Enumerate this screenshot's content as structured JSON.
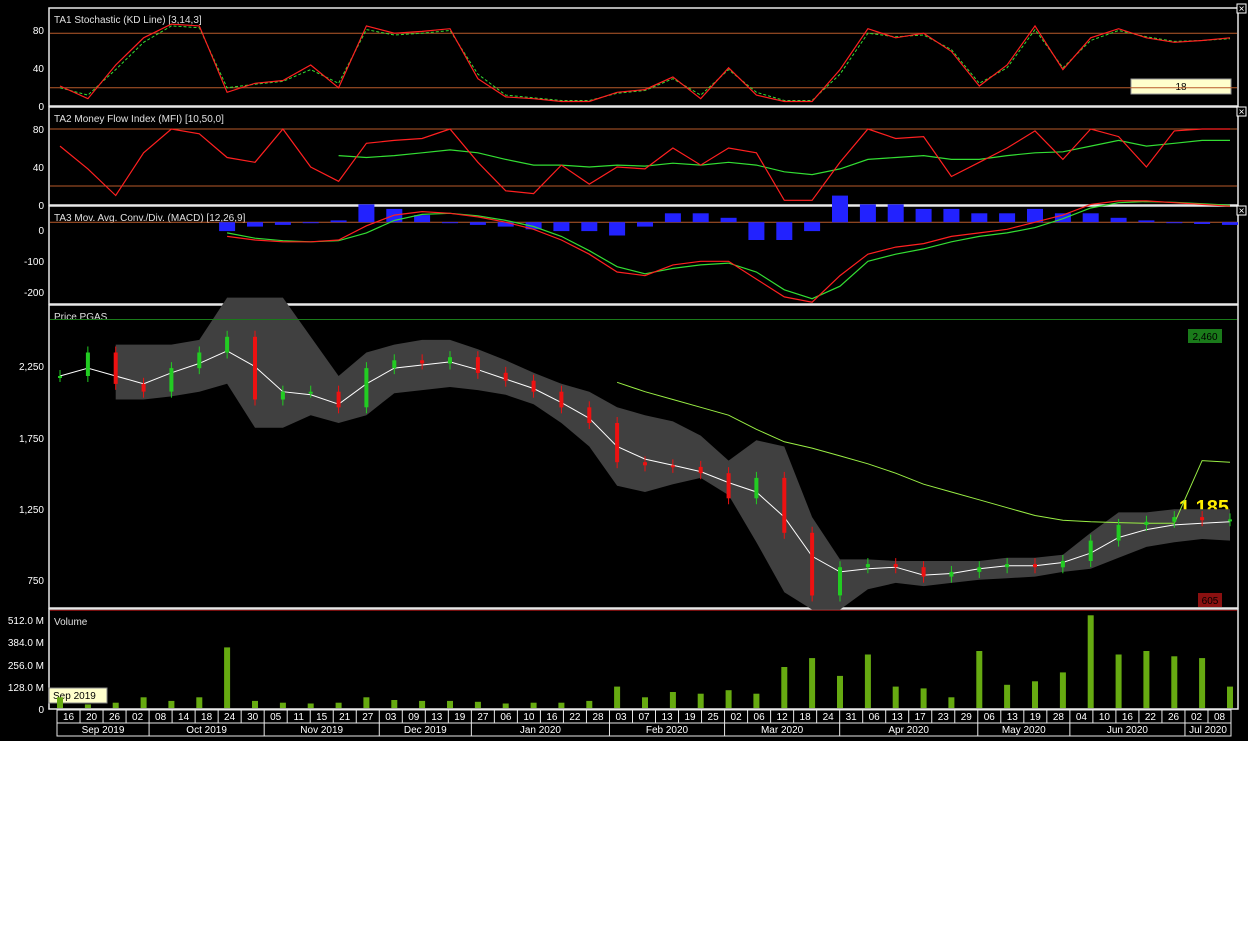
{
  "panels": {
    "stoch": {
      "title": "TA1 Stochastic (KD Line) [3,14,3]",
      "ticks": [
        "80",
        "40",
        "0"
      ],
      "badge": "18"
    },
    "mfi": {
      "title": "TA2 Money Flow Index (MFI) [10,50,0]",
      "ticks": [
        "80",
        "40",
        "0"
      ]
    },
    "macd": {
      "title": "TA3 Mov. Avg. Conv./Div. (MACD) [12,26,9]",
      "ticks": [
        "0",
        "-100",
        "-200"
      ]
    },
    "price": {
      "title": "Price PGAS",
      "ticks": [
        "2,250",
        "1,750",
        "1,250",
        "750"
      ],
      "high_label": "2,460",
      "low_label": "605",
      "last_label": "1.185"
    },
    "volume": {
      "title": "Volume",
      "ticks": [
        "512.0 M",
        "384.0 M",
        "256.0 M",
        "128.0 M",
        "0"
      ],
      "tooltip": "Sep 2019"
    }
  },
  "xaxis": {
    "days": [
      "16",
      "20",
      "26",
      "02",
      "08",
      "14",
      "18",
      "24",
      "30",
      "05",
      "11",
      "15",
      "21",
      "27",
      "03",
      "09",
      "13",
      "19",
      "27",
      "06",
      "10",
      "16",
      "22",
      "28",
      "03",
      "07",
      "13",
      "19",
      "25",
      "02",
      "06",
      "12",
      "18",
      "24",
      "31",
      "06",
      "13",
      "17",
      "23",
      "29",
      "06",
      "13",
      "19",
      "28",
      "04",
      "10",
      "16",
      "22",
      "26",
      "02",
      "08"
    ],
    "months": [
      "Sep 2019",
      "Oct 2019",
      "Nov 2019",
      "Dec 2019",
      "Jan 2020",
      "Feb 2020",
      "Mar 2020",
      "Apr 2020",
      "May 2020",
      "Jun 2020",
      "Jul 2020"
    ]
  },
  "colors": {
    "background": "#000000",
    "up": "#22cc22",
    "down": "#ee1111",
    "stoch_k": "#ff2020",
    "stoch_d": "#33dd33",
    "histogram": "#2222ff",
    "band": "#404040",
    "ma_long": "#99ee44",
    "volume": "#66aa11",
    "last_price": "#ffee00"
  },
  "chart_data": [
    {
      "type": "line",
      "title": "TA1 Stochastic (KD Line) [3,14,3]",
      "ylim": [
        0,
        100
      ],
      "reference_lines": [
        80,
        20
      ],
      "x": [
        "2019-09-16",
        "2019-09-24",
        "2019-10-01",
        "2019-10-08",
        "2019-10-15",
        "2019-10-22",
        "2019-10-29",
        "2019-11-05",
        "2019-11-12",
        "2019-11-19",
        "2019-11-26",
        "2019-12-03",
        "2019-12-10",
        "2019-12-17",
        "2019-12-24",
        "2019-12-31",
        "2020-01-07",
        "2020-01-14",
        "2020-01-21",
        "2020-01-28",
        "2020-02-04",
        "2020-02-11",
        "2020-02-18",
        "2020-02-25",
        "2020-03-03",
        "2020-03-10",
        "2020-03-17",
        "2020-03-24",
        "2020-03-31",
        "2020-04-07",
        "2020-04-14",
        "2020-04-21",
        "2020-04-28",
        "2020-05-05",
        "2020-05-12",
        "2020-05-19",
        "2020-05-26",
        "2020-06-02",
        "2020-06-09",
        "2020-06-16",
        "2020-06-23",
        "2020-06-30",
        "2020-07-08"
      ],
      "series": [
        {
          "name": "K",
          "values": [
            22,
            8,
            45,
            75,
            90,
            88,
            15,
            25,
            28,
            45,
            20,
            88,
            80,
            82,
            85,
            30,
            10,
            8,
            5,
            5,
            15,
            18,
            32,
            8,
            42,
            12,
            5,
            5,
            40,
            85,
            75,
            80,
            60,
            22,
            45,
            88,
            40,
            75,
            85,
            75,
            70,
            72,
            75
          ]
        },
        {
          "name": "D",
          "values": [
            20,
            12,
            40,
            70,
            88,
            86,
            20,
            24,
            27,
            40,
            25,
            84,
            78,
            80,
            83,
            35,
            12,
            9,
            6,
            6,
            14,
            17,
            30,
            12,
            40,
            15,
            6,
            6,
            35,
            80,
            76,
            78,
            62,
            25,
            42,
            84,
            42,
            72,
            83,
            76,
            71,
            72,
            74
          ]
        }
      ]
    },
    {
      "type": "line",
      "title": "TA2 Money Flow Index (MFI) [10,50,0]",
      "ylim": [
        0,
        100
      ],
      "reference_lines": [
        80,
        20
      ],
      "x": [
        "2019-09-16",
        "2019-09-24",
        "2019-10-01",
        "2019-10-08",
        "2019-10-15",
        "2019-10-22",
        "2019-10-29",
        "2019-11-05",
        "2019-11-12",
        "2019-11-19",
        "2019-11-26",
        "2019-12-03",
        "2019-12-10",
        "2019-12-17",
        "2019-12-24",
        "2019-12-31",
        "2020-01-07",
        "2020-01-14",
        "2020-01-21",
        "2020-01-28",
        "2020-02-04",
        "2020-02-11",
        "2020-02-18",
        "2020-02-25",
        "2020-03-03",
        "2020-03-10",
        "2020-03-17",
        "2020-03-24",
        "2020-03-31",
        "2020-04-07",
        "2020-04-14",
        "2020-04-21",
        "2020-04-28",
        "2020-05-05",
        "2020-05-12",
        "2020-05-19",
        "2020-05-26",
        "2020-06-02",
        "2020-06-09",
        "2020-06-16",
        "2020-06-23",
        "2020-06-30",
        "2020-07-08"
      ],
      "series": [
        {
          "name": "MFI",
          "values": [
            62,
            38,
            10,
            55,
            80,
            75,
            50,
            45,
            80,
            40,
            25,
            65,
            68,
            70,
            80,
            45,
            15,
            12,
            42,
            22,
            40,
            38,
            60,
            42,
            60,
            55,
            5,
            5,
            45,
            80,
            70,
            72,
            30,
            45,
            60,
            78,
            48,
            80,
            72,
            40,
            78,
            80,
            80
          ]
        },
        {
          "name": "MFI signal",
          "values": [
            null,
            null,
            null,
            null,
            null,
            null,
            null,
            null,
            null,
            null,
            52,
            50,
            52,
            55,
            58,
            55,
            48,
            42,
            42,
            40,
            42,
            41,
            44,
            42,
            45,
            42,
            35,
            32,
            38,
            48,
            50,
            52,
            48,
            48,
            52,
            55,
            56,
            62,
            68,
            62,
            65,
            68,
            68
          ]
        }
      ]
    },
    {
      "type": "line",
      "title": "TA3 Mov. Avg. Conv./Div. (MACD) [12,26,9]",
      "ylim": [
        -230,
        40
      ],
      "x": [
        "2019-09-16",
        "2019-09-24",
        "2019-10-01",
        "2019-10-08",
        "2019-10-15",
        "2019-10-22",
        "2019-10-29",
        "2019-11-05",
        "2019-11-12",
        "2019-11-19",
        "2019-11-26",
        "2019-12-03",
        "2019-12-10",
        "2019-12-17",
        "2019-12-24",
        "2019-12-31",
        "2020-01-07",
        "2020-01-14",
        "2020-01-21",
        "2020-01-28",
        "2020-02-04",
        "2020-02-11",
        "2020-02-18",
        "2020-02-25",
        "2020-03-03",
        "2020-03-10",
        "2020-03-17",
        "2020-03-24",
        "2020-03-31",
        "2020-04-07",
        "2020-04-14",
        "2020-04-21",
        "2020-04-28",
        "2020-05-05",
        "2020-05-12",
        "2020-05-19",
        "2020-05-26",
        "2020-06-02",
        "2020-06-09",
        "2020-06-16",
        "2020-06-23",
        "2020-06-30",
        "2020-07-08"
      ],
      "series": [
        {
          "name": "MACD",
          "values": [
            null,
            null,
            null,
            null,
            null,
            null,
            -40,
            -50,
            -55,
            -55,
            -50,
            -10,
            20,
            30,
            25,
            15,
            0,
            -20,
            -50,
            -90,
            -140,
            -150,
            -120,
            -110,
            -110,
            -160,
            -210,
            -225,
            -150,
            -90,
            -70,
            -60,
            -40,
            -30,
            -20,
            0,
            20,
            50,
            60,
            60,
            55,
            50,
            45
          ]
        },
        {
          "name": "Signal",
          "values": [
            null,
            null,
            null,
            null,
            null,
            null,
            -30,
            -45,
            -52,
            -55,
            -52,
            -30,
            5,
            22,
            25,
            18,
            5,
            -12,
            -40,
            -80,
            -125,
            -145,
            -130,
            -120,
            -115,
            -140,
            -190,
            -215,
            -180,
            -110,
            -90,
            -75,
            -55,
            -40,
            -30,
            -15,
            10,
            40,
            55,
            58,
            56,
            52,
            48
          ]
        }
      ]
    },
    {
      "type": "line",
      "title": "Price PGAS",
      "ylim": [
        620,
        2540
      ],
      "reference_lines": [
        2460,
        605
      ],
      "last_price": 1185,
      "x": [
        "2019-09-16",
        "2019-09-24",
        "2019-10-01",
        "2019-10-08",
        "2019-10-15",
        "2019-10-22",
        "2019-10-29",
        "2019-11-05",
        "2019-11-12",
        "2019-11-19",
        "2019-11-26",
        "2019-12-03",
        "2019-12-10",
        "2019-12-17",
        "2019-12-24",
        "2019-12-31",
        "2020-01-07",
        "2020-01-14",
        "2020-01-21",
        "2020-01-28",
        "2020-02-04",
        "2020-02-11",
        "2020-02-18",
        "2020-02-25",
        "2020-03-03",
        "2020-03-10",
        "2020-03-17",
        "2020-03-24",
        "2020-03-31",
        "2020-04-07",
        "2020-04-14",
        "2020-04-21",
        "2020-04-28",
        "2020-05-05",
        "2020-05-12",
        "2020-05-19",
        "2020-05-26",
        "2020-06-02",
        "2020-06-09",
        "2020-06-16",
        "2020-06-23",
        "2020-06-30",
        "2020-07-08"
      ],
      "series": [
        {
          "name": "Close",
          "values": [
            2100,
            2250,
            2050,
            2000,
            2150,
            2250,
            2350,
            1950,
            2000,
            2000,
            1900,
            2150,
            2200,
            2180,
            2220,
            2120,
            2070,
            2000,
            1900,
            1800,
            1550,
            1530,
            1520,
            1480,
            1320,
            1450,
            1100,
            700,
            880,
            900,
            880,
            820,
            850,
            880,
            900,
            880,
            920,
            1050,
            1150,
            1170,
            1200,
            1180,
            1185
          ]
        },
        {
          "name": "MA",
          "values": [
            2100,
            2150,
            2100,
            2050,
            2120,
            2180,
            2260,
            2160,
            2000,
            1980,
            1920,
            2050,
            2150,
            2170,
            2190,
            2140,
            2080,
            2020,
            1930,
            1830,
            1650,
            1570,
            1530,
            1490,
            1420,
            1360,
            1200,
            950,
            850,
            870,
            880,
            830,
            840,
            870,
            890,
            890,
            910,
            970,
            1070,
            1120,
            1150,
            1160,
            1170
          ]
        },
        {
          "name": "Upper band",
          "values": [
            null,
            null,
            2300,
            2300,
            2300,
            2330,
            2600,
            2600,
            2600,
            2350,
            2100,
            2250,
            2300,
            2330,
            2330,
            2270,
            2200,
            2120,
            2050,
            2000,
            1900,
            1850,
            1810,
            1720,
            1560,
            1690,
            1650,
            1200,
            930,
            930,
            920,
            920,
            920,
            920,
            940,
            940,
            960,
            1100,
            1230,
            1230,
            1250,
            1250,
            1250
          ]
        },
        {
          "name": "Lower band",
          "values": [
            null,
            null,
            1950,
            1950,
            1970,
            2000,
            2050,
            1770,
            1770,
            1850,
            1800,
            1850,
            1990,
            2010,
            2030,
            2010,
            1980,
            1920,
            1800,
            1650,
            1400,
            1360,
            1410,
            1450,
            1340,
            1040,
            720,
            610,
            610,
            740,
            780,
            760,
            780,
            800,
            810,
            820,
            850,
            870,
            940,
            1010,
            1040,
            1060,
            1050
          ]
        },
        {
          "name": "Long MA",
          "values": [
            null,
            null,
            null,
            null,
            null,
            null,
            null,
            null,
            null,
            null,
            null,
            null,
            null,
            null,
            null,
            null,
            null,
            null,
            null,
            null,
            2060,
            2000,
            1950,
            1900,
            1850,
            1760,
            1680,
            1640,
            1590,
            1540,
            1480,
            1410,
            1360,
            1310,
            1260,
            1210,
            1180,
            1170,
            1165,
            1160,
            1160,
            1560,
            1550
          ]
        }
      ]
    },
    {
      "type": "bar",
      "title": "Volume",
      "ylabel": "Volume",
      "ylim": [
        0,
        550
      ],
      "x": [
        "2019-09-16",
        "2019-09-24",
        "2019-10-01",
        "2019-10-08",
        "2019-10-15",
        "2019-10-22",
        "2019-10-29",
        "2019-11-05",
        "2019-11-12",
        "2019-11-19",
        "2019-11-26",
        "2019-12-03",
        "2019-12-10",
        "2019-12-17",
        "2019-12-24",
        "2019-12-31",
        "2020-01-07",
        "2020-01-14",
        "2020-01-21",
        "2020-01-28",
        "2020-02-04",
        "2020-02-11",
        "2020-02-18",
        "2020-02-25",
        "2020-03-03",
        "2020-03-10",
        "2020-03-17",
        "2020-03-24",
        "2020-03-31",
        "2020-04-07",
        "2020-04-14",
        "2020-04-21",
        "2020-04-28",
        "2020-05-05",
        "2020-05-12",
        "2020-05-19",
        "2020-05-26",
        "2020-06-02",
        "2020-06-09",
        "2020-06-16",
        "2020-06-23",
        "2020-06-30",
        "2020-07-08"
      ],
      "values": [
        60,
        20,
        30,
        60,
        40,
        60,
        340,
        40,
        30,
        25,
        30,
        60,
        45,
        40,
        40,
        35,
        25,
        30,
        30,
        40,
        120,
        60,
        90,
        80,
        100,
        80,
        230,
        280,
        180,
        300,
        120,
        110,
        60,
        320,
        130,
        150,
        200,
        520,
        300,
        320,
        290,
        280,
        120
      ]
    }
  ]
}
